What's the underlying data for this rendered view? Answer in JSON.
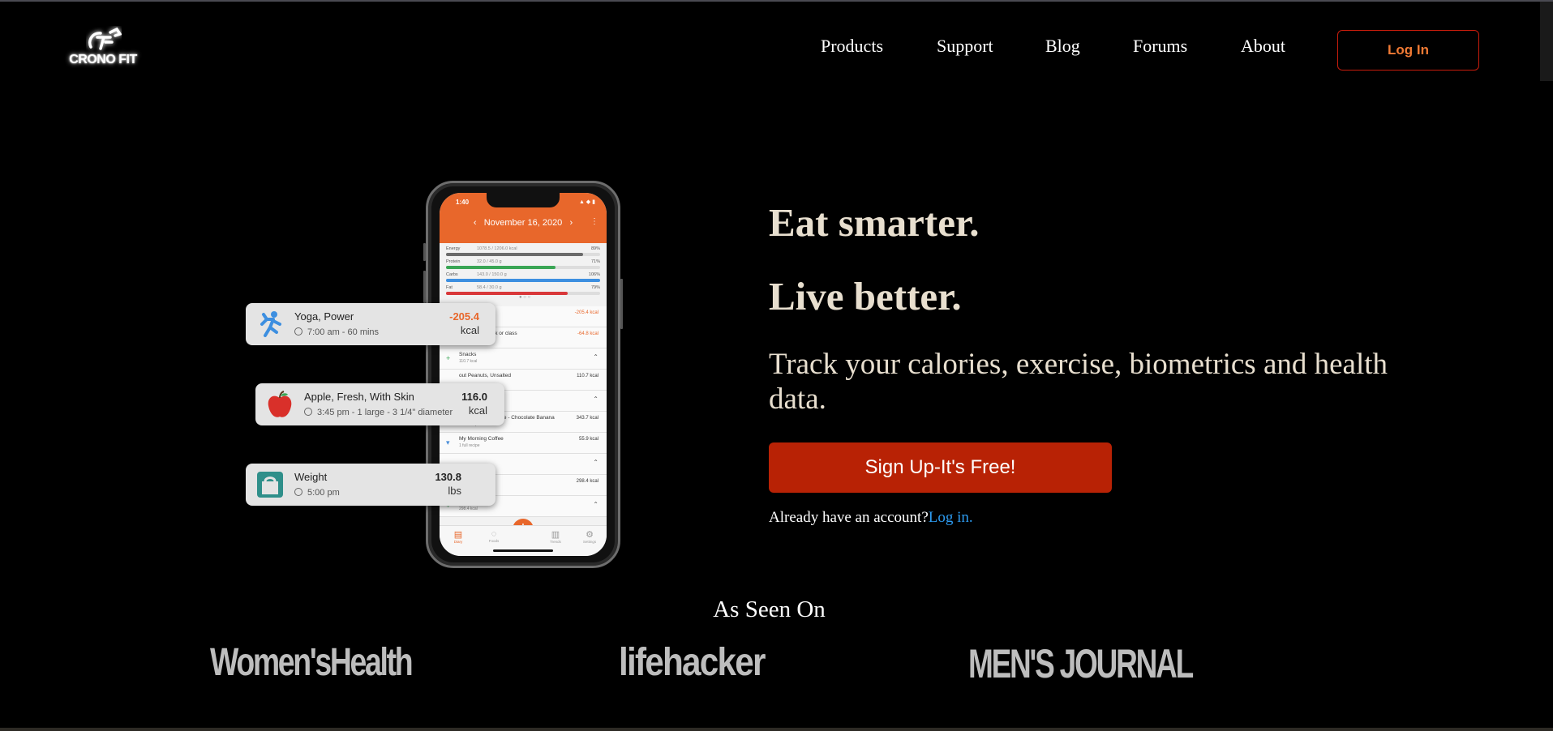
{
  "header": {
    "logo_mark": "CF",
    "logo_text": "CRONO FIT",
    "nav": [
      "Products",
      "Support",
      "Blog",
      "Forums",
      "About"
    ],
    "login_label": "Log In"
  },
  "phone_screen": {
    "time": "1:40",
    "date": "November 16, 2020",
    "macros": [
      {
        "name": "Energy",
        "amount": "1078.5 / 1206.0 kcal",
        "pct": "89%",
        "fill": 0.89,
        "color": "#6b6b6b"
      },
      {
        "name": "Protein",
        "amount": "32.0 / 45.0 g",
        "pct": "71%",
        "fill": 0.71,
        "color": "#3aa655"
      },
      {
        "name": "Carbs",
        "amount": "143.0 / 150.0 g",
        "pct": "106%",
        "fill": 1.0,
        "color": "#3d8fe0"
      },
      {
        "name": "Fat",
        "amount": "58.4 / 30.0 g",
        "pct": "79%",
        "fill": 0.79,
        "color": "#d9383a"
      }
    ],
    "rows": [
      {
        "title": "",
        "sub": "0 Mins",
        "value": "-205.4 kcal",
        "icon": "chevron-up-icon"
      },
      {
        "title": "Walking, to work or class",
        "sub": "2:00 pm - 20.0 Mins",
        "value": "-64.8 kcal",
        "icon": "runner-icon"
      },
      {
        "title": "Snacks",
        "sub": "110.7 kcal",
        "value": "",
        "icon": "plus-icon"
      },
      {
        "title": "out Peanuts, Unsalted",
        "sub": "",
        "value": "110.7 kcal",
        "icon": ""
      },
      {
        "title": "",
        "sub": "",
        "value": "",
        "icon": "chevron-up-icon"
      },
      {
        "title": "Breakfast: Smoothie - Chocolate Banana",
        "sub": "1 full recipe",
        "value": "343.7 kcal",
        "icon": "cup-icon"
      },
      {
        "title": "My Morning Coffee",
        "sub": "1 full recipe",
        "value": "55.9 kcal",
        "icon": "cup-icon"
      },
      {
        "title": "",
        "sub": "",
        "value": "",
        "icon": "chevron-up-icon"
      },
      {
        "title": "",
        "sub": "",
        "value": "298.4 kcal",
        "icon": ""
      },
      {
        "title": "Dinner",
        "sub": "298.4 kcal",
        "value": "",
        "icon": "plus-icon"
      }
    ],
    "tabs": [
      "Diary",
      "Foods",
      "",
      "Trends",
      "Settings"
    ]
  },
  "cards": [
    {
      "title": "Yoga, Power",
      "sub": "7:00 am - 60 mins",
      "value": "-205.4",
      "unit": "kcal",
      "value_color": "#e8672b",
      "icon": "runner-icon"
    },
    {
      "title": "Apple, Fresh, With Skin",
      "sub": "3:45 pm - 1 large - 3 1/4\" diameter",
      "value": "116.0",
      "unit": "kcal",
      "value_color": "#222222",
      "icon": "apple-icon"
    },
    {
      "title": "Weight",
      "sub": "5:00 pm",
      "value": "130.8",
      "unit": "lbs",
      "value_color": "#222222",
      "icon": "scale-icon"
    }
  ],
  "hero": {
    "headline1": "Eat smarter.",
    "headline2": "Live better.",
    "tagline": "Track your calories, exercise, biometrics and health data.",
    "signup_label": "Sign Up-It's Free!",
    "already_text": "Already have an account?",
    "login_link": "Log in."
  },
  "press": {
    "heading": "As Seen On",
    "logos": [
      "Women'sHealth",
      "lifehacker",
      "MEN'S JOURNAL"
    ]
  },
  "colors": {
    "accent_orange": "#e8672b",
    "cta_red": "#b82205",
    "link_blue": "#2d9bf0",
    "hero_text": "#e8dfcf"
  }
}
